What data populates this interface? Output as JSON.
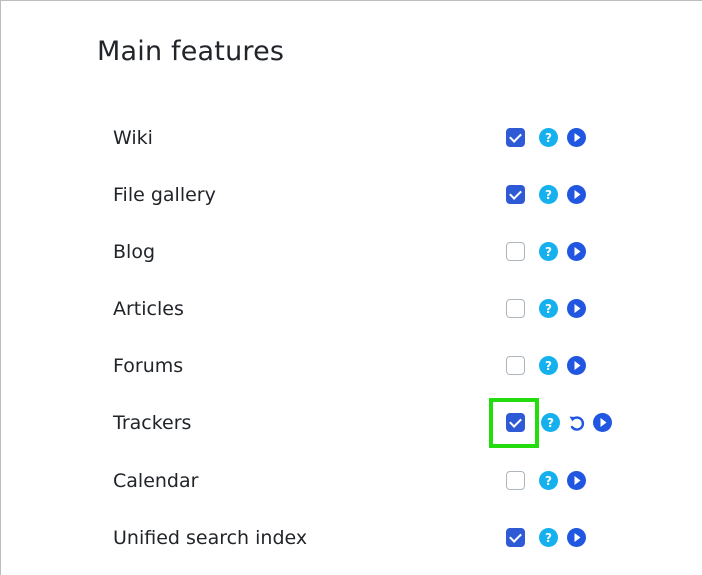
{
  "section": {
    "title": "Main features"
  },
  "features": [
    {
      "label": "Wiki",
      "checked": true,
      "modified": false
    },
    {
      "label": "File gallery",
      "checked": true,
      "modified": false
    },
    {
      "label": "Blog",
      "checked": false,
      "modified": false
    },
    {
      "label": "Articles",
      "checked": false,
      "modified": false
    },
    {
      "label": "Forums",
      "checked": false,
      "modified": false
    },
    {
      "label": "Trackers",
      "checked": true,
      "modified": true
    },
    {
      "label": "Calendar",
      "checked": false,
      "modified": false
    },
    {
      "label": "Unified search index",
      "checked": true,
      "modified": false
    }
  ],
  "icons": {
    "help": "help-icon",
    "apply": "play-icon",
    "reset": "undo-icon"
  },
  "colors": {
    "checkbox_checked": "#2e5ad6",
    "help_icon": "#15b1ee",
    "play_icon": "#2157e0",
    "highlight": "#22dc0e"
  },
  "highlighted_feature": "Trackers"
}
